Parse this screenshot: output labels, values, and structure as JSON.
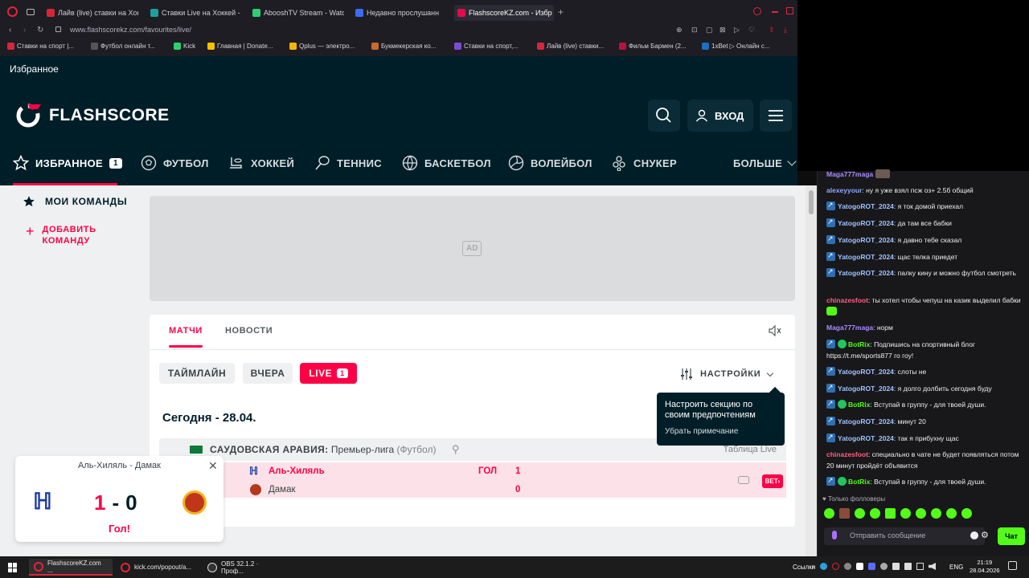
{
  "browser": {
    "tabs": [
      {
        "title": "Лайв (live) ставки на Хокк",
        "color": "#d6263a"
      },
      {
        "title": "Ставки Live на Хоккей - С",
        "color": "#1ba0a0"
      },
      {
        "title": "AbooshTV Stream - Watc",
        "color": "#2ed06e"
      },
      {
        "title": "Недавно прослушанн",
        "color": "#3c6cf0"
      },
      {
        "title": "FlashscoreKZ.com - Избр",
        "color": "#e30b4e"
      }
    ],
    "url": "www.flashscorekz.com/favourites/live/",
    "bookmarks": [
      {
        "label": "Ставки на спорт |...",
        "color": "#d6263a"
      },
      {
        "label": "Футбол онлайн т...",
        "color": "#555"
      },
      {
        "label": "Kick",
        "color": "#2ed06e"
      },
      {
        "label": "Главная | Donate...",
        "color": "#f2c200"
      },
      {
        "label": "Qplus — электро...",
        "color": "#f7b500"
      },
      {
        "label": "Букмекерская ко...",
        "color": "#c76a2a"
      },
      {
        "label": "Ставки на спорт,...",
        "color": "#7b4bd6"
      },
      {
        "label": "Лайв (live) ставки...",
        "color": "#d6263a"
      },
      {
        "label": "Фильм Бармен (2...",
        "color": "#b8123c"
      },
      {
        "label": "1xBet ▷ Онлайн с...",
        "color": "#1a6fc0"
      }
    ]
  },
  "page": {
    "title": "Избранное",
    "logo_text": "FLASHSCORE",
    "login_label": "ВХОД",
    "nav": [
      {
        "label": "ИЗБРАННОЕ",
        "count": "1"
      },
      {
        "label": "ФУТБОЛ"
      },
      {
        "label": "ХОККЕЙ"
      },
      {
        "label": "ТЕННИС"
      },
      {
        "label": "БАСКЕТБОЛ"
      },
      {
        "label": "ВОЛЕЙБОЛ"
      },
      {
        "label": "СНУКЕР"
      },
      {
        "label": "БОЛЬШЕ"
      }
    ],
    "sidebar": {
      "my_teams": "МОИ КОМАНДЫ",
      "add_team": "ДОБАВИТЬ КОМАНДУ"
    },
    "ad_label": "AD",
    "tabs": [
      "МАТЧИ",
      "НОВОСТИ"
    ],
    "filters": {
      "timeline": "ТАЙМЛАЙН",
      "yesterday": "ВЧЕРА",
      "live": "LIVE",
      "live_count": "1",
      "settings": "НАСТРОЙКИ"
    },
    "date_heading": "Сегодня - 28.04.",
    "tooltip": {
      "text": "Настроить секцию по своим предпочтениям",
      "dismiss": "Убрать примечание"
    },
    "league": {
      "country": "САУДОВСКАЯ АРАВИЯ:",
      "name": "Премьер-лига",
      "sport": "(Футбол)",
      "table_link": "Таблица Live"
    },
    "match": {
      "home": "Аль-Хиляль",
      "away": "Дамак",
      "home_score": "1",
      "away_score": "0",
      "event": "ГОЛ",
      "bet_label": "BET"
    },
    "popup": {
      "title": "Аль-Хиляль - Дамак",
      "home_score": "1",
      "separator": "-",
      "away_score": "0",
      "event": "Гол!"
    }
  },
  "chat": {
    "messages": [
      {
        "user": "Maga777maga",
        "color": "#a88bff",
        "text": ""
      },
      {
        "user": "alexeyyour",
        "color": "#8fa8ff",
        "text": ": ну я уже взял псж оз+ 2.5б общий"
      },
      {
        "user": "YatogoROT_2024",
        "color": "#9fc3ff",
        "text": ": я ток домой приехал",
        "badge": true
      },
      {
        "user": "YatogoROT_2024",
        "color": "#9fc3ff",
        "text": ": да там все бабки",
        "badge": true
      },
      {
        "user": "YatogoROT_2024",
        "color": "#9fc3ff",
        "text": ": я давно тебе сказал",
        "badge": true
      },
      {
        "user": "YatogoROT_2024",
        "color": "#9fc3ff",
        "text": ": щас телка приедет",
        "badge": true
      },
      {
        "user": "YatogoROT_2024",
        "color": "#9fc3ff",
        "text": ": палку кину и можно футбол смотреть",
        "badge": true
      },
      {
        "user": "chinazesfoot",
        "color": "#ff5f7e",
        "text": ": ты хотел чтобы чепуш на казик выделил бабки"
      },
      {
        "user": "Maga777maga",
        "color": "#a88bff",
        "text": ": норм"
      },
      {
        "user": "BotRix",
        "color": "#53fc18",
        "text": ": Подпишись на спортивный блог https://t.me/sports877 го гоу!",
        "badge": true,
        "verified": true
      },
      {
        "user": "YatogoROT_2024",
        "color": "#9fc3ff",
        "text": ": слоты не",
        "badge": true
      },
      {
        "user": "YatogoROT_2024",
        "color": "#9fc3ff",
        "text": ": я долго долбить сегодня буду",
        "badge": true
      },
      {
        "user": "BotRix",
        "color": "#53fc18",
        "text": ": Вступай в группу - для твоей души.",
        "badge": true,
        "verified": true
      },
      {
        "user": "YatogoROT_2024",
        "color": "#9fc3ff",
        "text": ": минут 20",
        "badge": true
      },
      {
        "user": "YatogoROT_2024",
        "color": "#9fc3ff",
        "text": ": так я прибухну щас",
        "badge": true
      },
      {
        "user": "chinazesfoot",
        "color": "#ff5f7e",
        "text": ": специально в чате не будет появляться потом 20 минут пройдёт объявится"
      },
      {
        "user": "BotRix",
        "color": "#53fc18",
        "text": ": Вступай в группу - для твоей души.",
        "badge": true,
        "verified": true
      }
    ],
    "followers_only": "Только фолловеры",
    "input_placeholder": "Отправить сообщение",
    "send_label": "Чат"
  },
  "taskbar": {
    "apps": [
      "FlashscoreKZ.com ...",
      "kick.com/popout/a...",
      "OBS 32.1.2 · Проф..."
    ],
    "links": "Ссылки",
    "lang": "ENG",
    "time": "21:19",
    "date": "28.04.2026"
  }
}
